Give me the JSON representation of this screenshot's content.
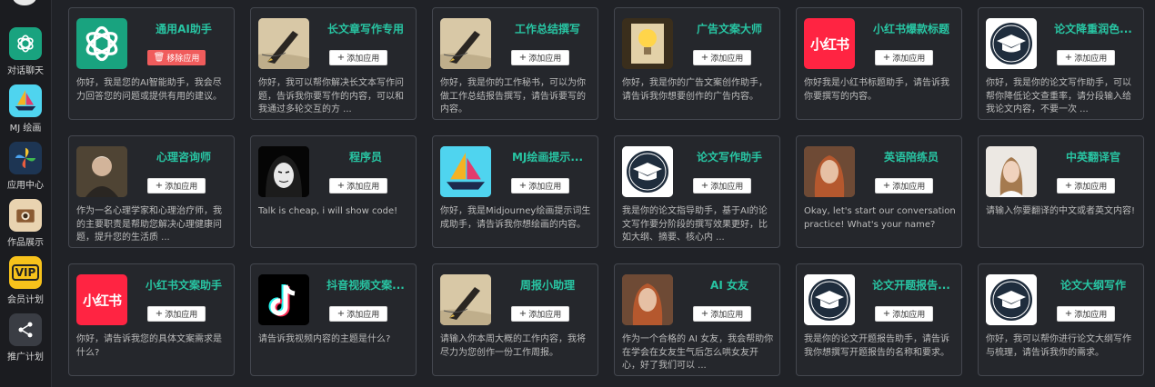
{
  "sidebar": {
    "items": [
      {
        "label": "对话聊天",
        "icon": "openai-logo-icon"
      },
      {
        "label": "MJ 绘画",
        "icon": "sailboat-icon"
      },
      {
        "label": "应用中心",
        "icon": "pinwheel-icon"
      },
      {
        "label": "作品展示",
        "icon": "camera-icon"
      },
      {
        "label": "会员计划",
        "icon": "vip-icon",
        "badge": "VIP"
      },
      {
        "label": "推广计划",
        "icon": "share-icon"
      }
    ]
  },
  "add_label": "添加应用",
  "remove_label": "移除应用",
  "cards": [
    {
      "title": "通用AI助手",
      "icon": "openai-logo-icon",
      "action": "remove",
      "desc": "你好，我是您的AI智能助手，我会尽力回答您的问题或提供有用的建议。"
    },
    {
      "title": "长文章写作专用",
      "icon": "fountain-pen-icon",
      "action": "add",
      "desc": "你好，我可以帮你解决长文本写作问题，告诉我你要写作的内容，可以和我通过多轮交互的方 ..."
    },
    {
      "title": "工作总结撰写",
      "icon": "fountain-pen-icon",
      "action": "add",
      "desc": "你好，我是你的工作秘书，可以为你做工作总结报告撰写，请告诉要写的内容。"
    },
    {
      "title": "广告文案大师",
      "icon": "lightbulb-icon",
      "action": "add",
      "desc": "你好，我是你的广告文案创作助手，请告诉我你想要创作的广告内容。"
    },
    {
      "title": "小红书爆款标题",
      "icon": "xiaohongshu-logo-icon",
      "logo_text": "小红书",
      "action": "add",
      "desc": "你好我是小红书标题助手，请告诉我你要撰写的内容。"
    },
    {
      "title": "论文降重润色...",
      "icon": "graduation-cap-icon",
      "action": "add",
      "desc": "你好，我是你的论文写作助手，可以帮你降低论文查重率，请分段输入给我论文内容，不要一次 ..."
    },
    {
      "title": "心理咨询师",
      "icon": "portrait-icon",
      "action": "add",
      "desc": "作为一名心理学家和心理治疗师，我的主要职责是帮助您解决心理健康问题，提升您的生活质 ..."
    },
    {
      "title": "程序员",
      "icon": "hacker-mask-icon",
      "action": "add",
      "desc": "Talk is cheap, i will show code!"
    },
    {
      "title": "MJ绘画提示...",
      "icon": "sailboat-icon",
      "action": "add",
      "desc": "你好，我是Midjourney绘画提示词生成助手，请告诉我你想绘画的内容。"
    },
    {
      "title": "论文写作助手",
      "icon": "graduation-cap-icon",
      "action": "add",
      "desc": "我是你的论文指导助手，基于AI的论文写作要分阶段的撰写效果更好，比如大纲、摘要、核心内 ..."
    },
    {
      "title": "英语陪练员",
      "icon": "woman-portrait-icon",
      "action": "add",
      "desc": "Okay, let's start our conversation practice! What's your name?"
    },
    {
      "title": "中英翻译官",
      "icon": "woman-headset-icon",
      "action": "add",
      "desc": "请输入你要翻译的中文或者英文内容!"
    },
    {
      "title": "小红书文案助手",
      "icon": "xiaohongshu-logo-icon",
      "logo_text": "小红书",
      "action": "add",
      "desc": "你好，请告诉我您的具体文案需求是什么?"
    },
    {
      "title": "抖音视频文案...",
      "icon": "tiktok-logo-icon",
      "action": "add",
      "desc": "请告诉我视频内容的主题是什么?"
    },
    {
      "title": "周报小助理",
      "icon": "fountain-pen-icon",
      "action": "add",
      "desc": "请输入你本周大概的工作内容，我将尽力为您创作一份工作周报。"
    },
    {
      "title": "AI 女友",
      "icon": "woman-portrait-icon",
      "action": "add",
      "desc": "作为一个合格的 AI 女友，我会帮助你在学会在女友生气后怎么哄女友开心，好了我们可以 ..."
    },
    {
      "title": "论文开题报告...",
      "icon": "graduation-cap-icon",
      "action": "add",
      "desc": "我是你的论文开题报告助手，请告诉我你想撰写开题报告的名称和要求。"
    },
    {
      "title": "论文大纲写作",
      "icon": "graduation-cap-icon",
      "action": "add",
      "desc": "你好，我可以帮你进行论文大纲写作与梳理，请告诉我你的需求。"
    }
  ]
}
